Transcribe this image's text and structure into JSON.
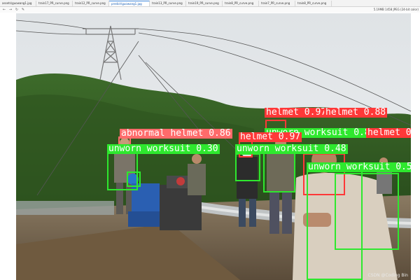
{
  "tabs": [
    {
      "label": "assets\\guowang1.jpg"
    },
    {
      "label": "train17_PR_curve.png"
    },
    {
      "label": "train12_PR_curve.png"
    },
    {
      "label": "predict\\guowang1.jpg",
      "active": true
    },
    {
      "label": "train13_PR_curve.png"
    },
    {
      "label": "train19_PR_curve.png"
    },
    {
      "label": "train8_PR_curve.png"
    },
    {
      "label": "train7_PR_curve.png"
    },
    {
      "label": "train8_PR_curve.png"
    }
  ],
  "toolbar": {
    "icons": [
      "back-icon",
      "forward-icon",
      "refresh-icon",
      "pen-icon"
    ],
    "file_info": "5.19MB  1458  JPEG  (24-bit color)"
  },
  "detections": [
    {
      "label": "helmet 0.97",
      "color": "#ff3838"
    },
    {
      "label": "helmet 0.88",
      "color": "#ff3838"
    },
    {
      "label": "abnormal helmet 0.86",
      "color": "#ff6b6b"
    },
    {
      "label": "unworn worksuit 0.89",
      "color": "#2ee82e"
    },
    {
      "label": "unworn worksuit 0.30",
      "color": "#2ee82e"
    },
    {
      "label": "helmet 0.97",
      "color": "#ff3838"
    },
    {
      "label": "unworn worksuit 0.48",
      "color": "#2ee82e"
    },
    {
      "label": "unworn worksuit 0.5",
      "color": "#2ee82e"
    },
    {
      "label": "helmet 0.",
      "color": "#ff3838"
    }
  ],
  "watermark": "CSDN @Coding Bin"
}
